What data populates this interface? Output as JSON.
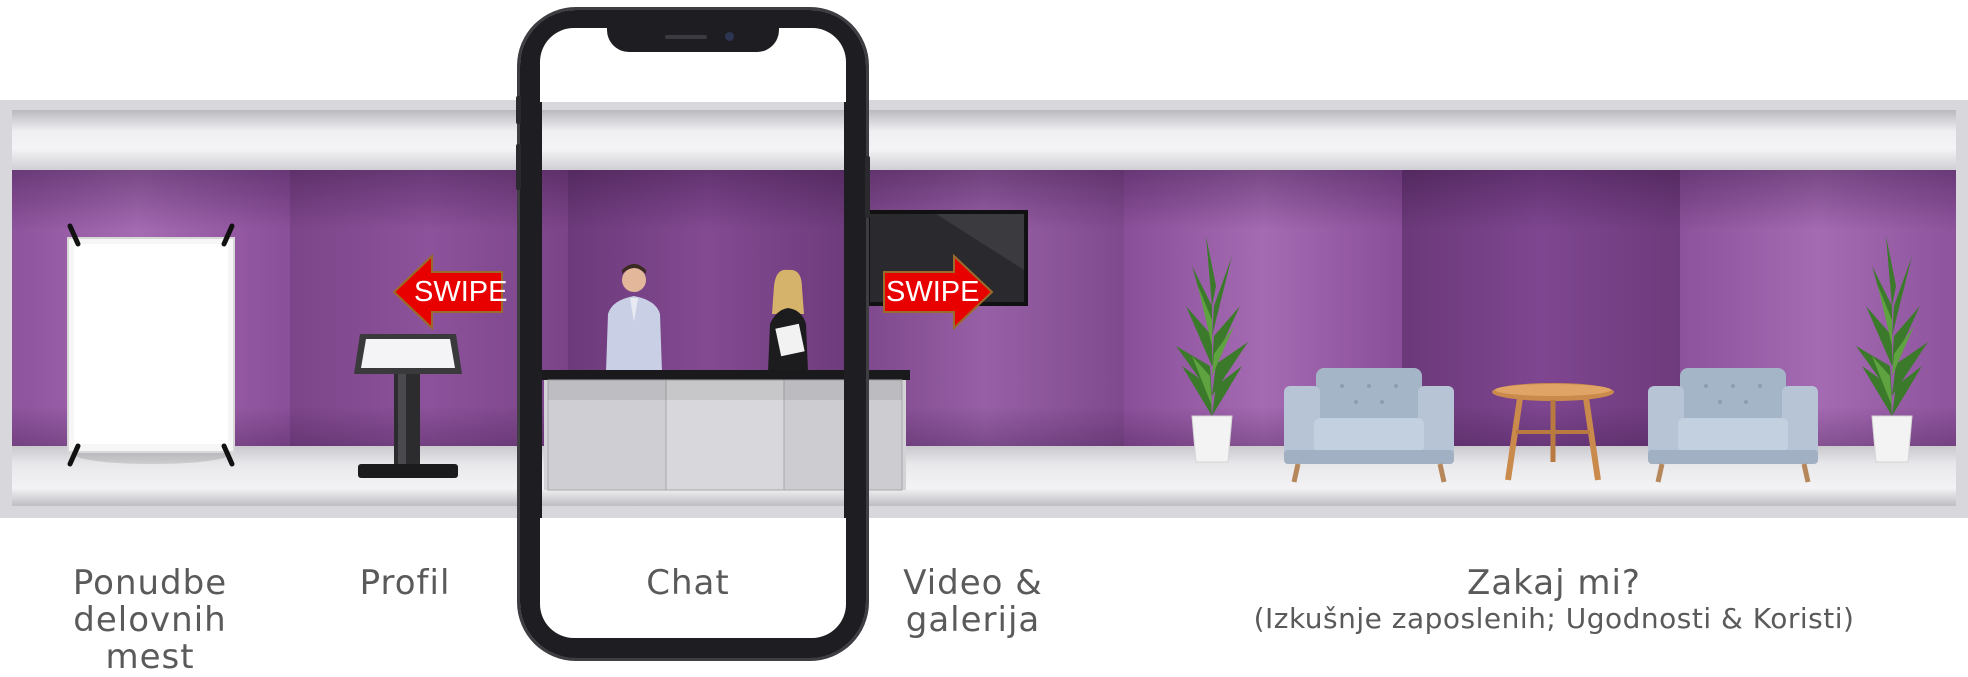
{
  "swipe_left": {
    "text": "SWIPE"
  },
  "swipe_right": {
    "text": "SWIPE"
  },
  "nav": {
    "offers_label": "Ponudbe\ndelovnih\nmest",
    "profile_label": "Profil",
    "chat_label": "Chat",
    "video_label": "Video &\ngalerija",
    "why_title": "Zakaj mi?",
    "why_subtitle": "(Izkušnje zaposlenih; Ugodnosti & Koristi)"
  },
  "colors": {
    "wall": "#8a4f9a",
    "arrow": "#e80000",
    "label_text": "#5a5a5a"
  },
  "icons": [
    "poster-stand",
    "kiosk",
    "reception-desk",
    "tv-screen",
    "plant",
    "armchair",
    "side-table",
    "smartphone",
    "swipe-arrow-left",
    "swipe-arrow-right"
  ]
}
